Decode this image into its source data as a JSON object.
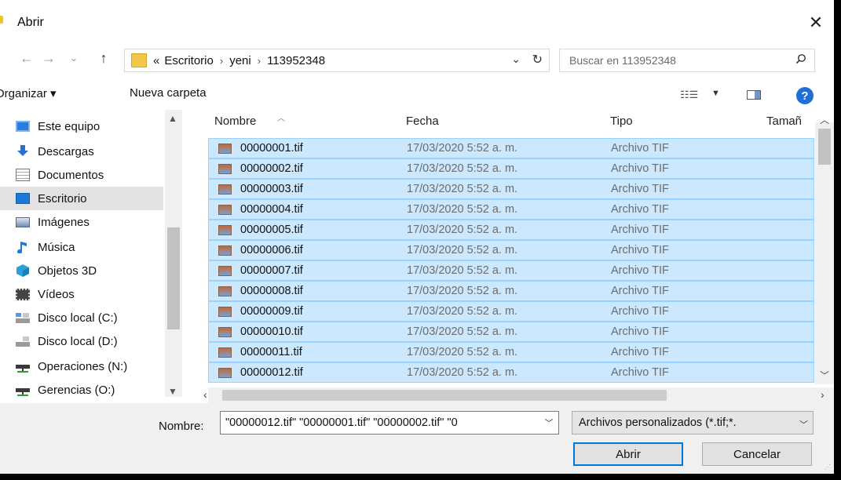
{
  "window": {
    "title": "Abrir",
    "close_glyph": "✕"
  },
  "address": {
    "breadcrumb_prefix": "«",
    "crumbs": [
      "Escritorio",
      "yeni",
      "113952348"
    ],
    "separator": "›",
    "dropdown_glyph": "⌄",
    "refresh_glyph": "↻"
  },
  "nav_buttons": {
    "back": "←",
    "forward": "→",
    "recent": "⌄",
    "up": "↑"
  },
  "search": {
    "placeholder": "Buscar en 113952348",
    "icon": "search-icon"
  },
  "toolbar": {
    "organize_label": "Organizar ▾",
    "new_folder_label": "Nueva carpeta",
    "help_glyph": "?"
  },
  "nav": {
    "items": [
      {
        "label": "Este equipo",
        "icon": "computer-icon",
        "color": "#2b7be0"
      },
      {
        "label": "Descargas",
        "icon": "download-icon",
        "color": "#2b6fd0"
      },
      {
        "label": "Documentos",
        "icon": "document-icon",
        "color": "#8a8a8a"
      },
      {
        "label": "Escritorio",
        "icon": "desktop-icon",
        "color": "#1f78d6",
        "selected": true
      },
      {
        "label": "Imágenes",
        "icon": "pictures-icon",
        "color": "#6a8fb8"
      },
      {
        "label": "Música",
        "icon": "music-icon",
        "color": "#1e7ad6"
      },
      {
        "label": "Objetos 3D",
        "icon": "cube-icon",
        "color": "#2aa0d8"
      },
      {
        "label": "Vídeos",
        "icon": "film-icon",
        "color": "#444444"
      },
      {
        "label": "Disco local (C:)",
        "icon": "drive-icon",
        "color": "#5a9ad8"
      },
      {
        "label": "Disco local (D:)",
        "icon": "drive-icon",
        "color": "#8a8a8a"
      },
      {
        "label": "Operaciones (N:)",
        "icon": "network-drive-icon",
        "color": "#3a3a3a"
      },
      {
        "label": "Gerencias (O:)",
        "icon": "network-drive-icon",
        "color": "#3a3a3a"
      }
    ]
  },
  "columns": {
    "name": "Nombre",
    "date": "Fecha",
    "type": "Tipo",
    "size": "Tamañ"
  },
  "files": [
    {
      "name": "00000001.tif",
      "date": "17/03/2020 5:52 a. m.",
      "type": "Archivo TIF"
    },
    {
      "name": "00000002.tif",
      "date": "17/03/2020 5:52 a. m.",
      "type": "Archivo TIF"
    },
    {
      "name": "00000003.tif",
      "date": "17/03/2020 5:52 a. m.",
      "type": "Archivo TIF"
    },
    {
      "name": "00000004.tif",
      "date": "17/03/2020 5:52 a. m.",
      "type": "Archivo TIF"
    },
    {
      "name": "00000005.tif",
      "date": "17/03/2020 5:52 a. m.",
      "type": "Archivo TIF"
    },
    {
      "name": "00000006.tif",
      "date": "17/03/2020 5:52 a. m.",
      "type": "Archivo TIF"
    },
    {
      "name": "00000007.tif",
      "date": "17/03/2020 5:52 a. m.",
      "type": "Archivo TIF"
    },
    {
      "name": "00000008.tif",
      "date": "17/03/2020 5:52 a. m.",
      "type": "Archivo TIF"
    },
    {
      "name": "00000009.tif",
      "date": "17/03/2020 5:52 a. m.",
      "type": "Archivo TIF"
    },
    {
      "name": "00000010.tif",
      "date": "17/03/2020 5:52 a. m.",
      "type": "Archivo TIF"
    },
    {
      "name": "00000011.tif",
      "date": "17/03/2020 5:52 a. m.",
      "type": "Archivo TIF"
    },
    {
      "name": "00000012.tif",
      "date": "17/03/2020 5:52 a. m.",
      "type": "Archivo TIF"
    }
  ],
  "bottom": {
    "filename_label": "Nombre:",
    "filename_value": "\"00000012.tif\" \"00000001.tif\" \"00000002.tif\" \"0",
    "filetype_value": "Archivos personalizados (*.tif;*.",
    "open_label": "Abrir",
    "cancel_label": "Cancelar"
  },
  "colors": {
    "selection_bg": "#cce8ff",
    "selection_border": "#99d1ff",
    "accent": "#0078d7"
  }
}
